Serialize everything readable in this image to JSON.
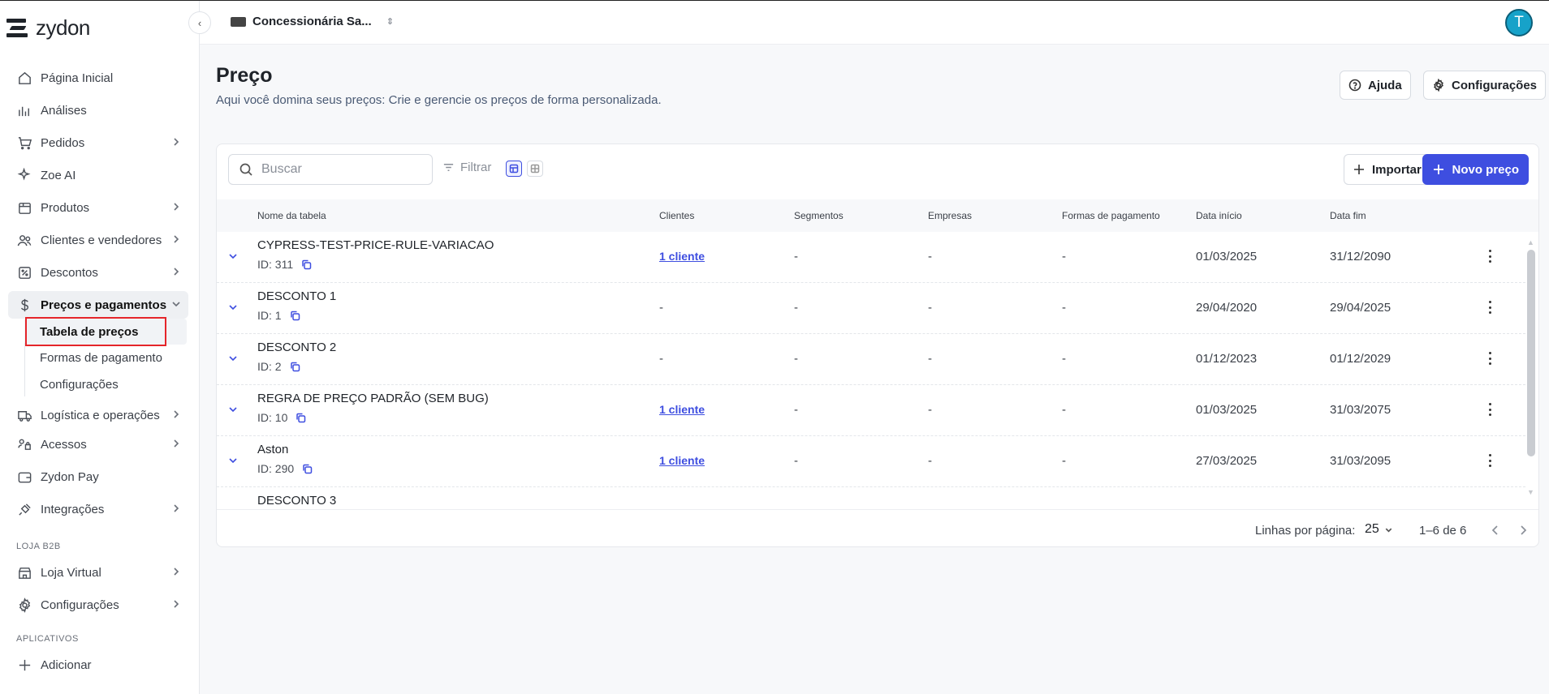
{
  "brand": {
    "name": "zydon"
  },
  "topbar": {
    "store_name": "Concessionária Sa...",
    "avatar_initial": "T"
  },
  "sidebar": {
    "items": [
      {
        "label": "Página Inicial",
        "icon": "home-icon",
        "has_chevron": false
      },
      {
        "label": "Análises",
        "icon": "bar-chart-icon",
        "has_chevron": false
      },
      {
        "label": "Pedidos",
        "icon": "cart-icon",
        "has_chevron": true
      },
      {
        "label": "Zoe AI",
        "icon": "sparkle-icon",
        "has_chevron": false
      },
      {
        "label": "Produtos",
        "icon": "box-icon",
        "has_chevron": true
      },
      {
        "label": "Clientes e vendedores",
        "icon": "users-icon",
        "has_chevron": true
      },
      {
        "label": "Descontos",
        "icon": "discount-icon",
        "has_chevron": true
      },
      {
        "label": "Preços e pagamentos",
        "icon": "dollar-icon",
        "has_chevron": true,
        "expanded": true
      },
      {
        "label": "Logística e operações",
        "icon": "truck-icon",
        "has_chevron": true
      },
      {
        "label": "Acessos",
        "icon": "access-icon",
        "has_chevron": true
      },
      {
        "label": "Zydon Pay",
        "icon": "wallet-icon",
        "has_chevron": false
      },
      {
        "label": "Integrações",
        "icon": "plug-icon",
        "has_chevron": true
      }
    ],
    "subitems": [
      {
        "label": "Tabela de preços",
        "active": true
      },
      {
        "label": "Formas de pagamento",
        "active": false
      },
      {
        "label": "Configurações",
        "active": false
      }
    ],
    "section_b2b": "LOJA B2B",
    "b2b_items": [
      {
        "label": "Loja Virtual",
        "icon": "store-icon"
      },
      {
        "label": "Configurações",
        "icon": "gear-icon"
      }
    ],
    "section_apps": "APLICATIVOS",
    "apps_add": "Adicionar"
  },
  "header": {
    "title": "Preço",
    "subtitle": "Aqui você domina seus preços: Crie e gerencie os preços de forma personalizada.",
    "help_label": "Ajuda",
    "settings_label": "Configurações"
  },
  "toolbar": {
    "search_placeholder": "Buscar",
    "filter_label": "Filtrar",
    "import_label": "Importar",
    "new_label": "Novo preço"
  },
  "table": {
    "columns": [
      "Nome da tabela",
      "Clientes",
      "Segmentos",
      "Empresas",
      "Formas de pagamento",
      "Data início",
      "Data fim"
    ],
    "rows": [
      {
        "name": "CYPRESS-TEST-PRICE-RULE-VARIACAO",
        "id": "ID: 311",
        "clientes": "1 cliente",
        "segmentos": "-",
        "empresas": "-",
        "formas": "-",
        "inicio": "01/03/2025",
        "fim": "31/12/2090"
      },
      {
        "name": "DESCONTO 1",
        "id": "ID: 1",
        "clientes": "-",
        "segmentos": "-",
        "empresas": "-",
        "formas": "-",
        "inicio": "29/04/2020",
        "fim": "29/04/2025"
      },
      {
        "name": "DESCONTO 2",
        "id": "ID: 2",
        "clientes": "-",
        "segmentos": "-",
        "empresas": "-",
        "formas": "-",
        "inicio": "01/12/2023",
        "fim": "01/12/2029"
      },
      {
        "name": "REGRA DE PREÇO PADRÃO (SEM BUG)",
        "id": "ID: 10",
        "clientes": "1 cliente",
        "segmentos": "-",
        "empresas": "-",
        "formas": "-",
        "inicio": "01/03/2025",
        "fim": "31/03/2075"
      },
      {
        "name": "Aston",
        "id": "ID: 290",
        "clientes": "1 cliente",
        "segmentos": "-",
        "empresas": "-",
        "formas": "-",
        "inicio": "27/03/2025",
        "fim": "31/03/2095"
      },
      {
        "name": "DESCONTO 3",
        "id": "",
        "clientes": "",
        "segmentos": "",
        "empresas": "",
        "formas": "",
        "inicio": "",
        "fim": ""
      }
    ]
  },
  "pagination": {
    "label": "Linhas por página:",
    "per_page": "25",
    "range": "1–6 de 6"
  },
  "colors": {
    "accent": "#3e4ee0",
    "highlight_border": "#e5252a",
    "avatar": "#17a2c9"
  }
}
